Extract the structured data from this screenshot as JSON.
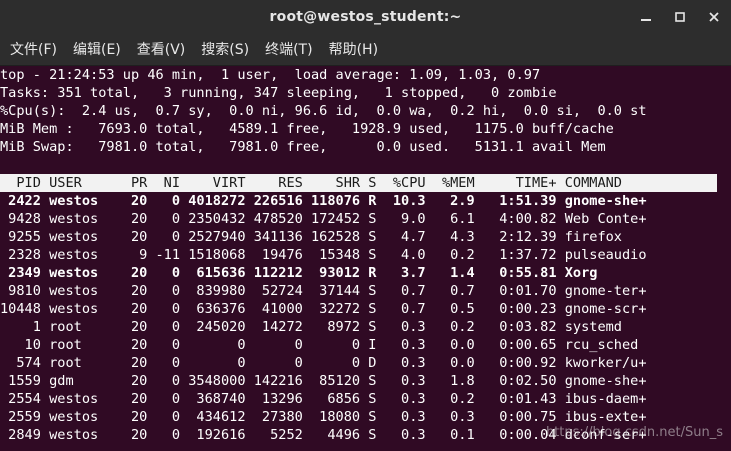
{
  "window": {
    "title": "root@westos_student:~"
  },
  "menu": [
    "文件(F)",
    "编辑(E)",
    "查看(V)",
    "搜索(S)",
    "终端(T)",
    "帮助(H)"
  ],
  "terminal": {
    "summary": [
      "top - 21:24:53 up 46 min,  1 user,  load average: 1.09, 1.03, 0.97",
      "Tasks: 351 total,   3 running, 347 sleeping,   1 stopped,   0 zombie",
      "%Cpu(s):  2.4 us,  0.7 sy,  0.0 ni, 96.6 id,  0.0 wa,  0.2 hi,  0.0 si,  0.0 st",
      "MiB Mem :   7693.0 total,   4589.1 free,   1928.9 used,   1175.0 buff/cache",
      "MiB Swap:   7981.0 total,   7981.0 free,      0.0 used.   5131.1 avail Mem"
    ],
    "blank": " ",
    "header": "  PID USER      PR  NI    VIRT    RES    SHR S  %CPU  %MEM     TIME+ COMMAND",
    "processes": [
      {
        "text": " 2422 westos    20   0 4018272 226516 118076 R  10.3   2.9   1:51.39 gnome-she+",
        "bold": true
      },
      {
        "text": " 9428 westos    20   0 2350432 478520 172452 S   9.0   6.1   4:00.82 Web Conte+",
        "bold": false
      },
      {
        "text": " 9255 westos    20   0 2527940 341136 162528 S   4.7   4.3   2:12.39 firefox",
        "bold": false
      },
      {
        "text": " 2328 westos     9 -11 1518068  19476  15348 S   4.0   0.2   1:37.72 pulseaudio",
        "bold": false
      },
      {
        "text": " 2349 westos    20   0  615636 112212  93012 R   3.7   1.4   0:55.81 Xorg",
        "bold": true
      },
      {
        "text": " 9810 westos    20   0  839980  52724  37144 S   0.7   0.7   0:01.70 gnome-ter+",
        "bold": false
      },
      {
        "text": "10448 westos    20   0  636376  41000  32272 S   0.7   0.5   0:00.23 gnome-scr+",
        "bold": false
      },
      {
        "text": "    1 root      20   0  245020  14272   8972 S   0.3   0.2   0:03.82 systemd",
        "bold": false
      },
      {
        "text": "   10 root      20   0       0      0      0 I   0.3   0.0   0:00.65 rcu_sched",
        "bold": false
      },
      {
        "text": "  574 root      20   0       0      0      0 D   0.3   0.0   0:00.92 kworker/u+",
        "bold": false
      },
      {
        "text": " 1559 gdm       20   0 3548000 142216  85120 S   0.3   1.8   0:02.50 gnome-she+",
        "bold": false
      },
      {
        "text": " 2554 westos    20   0  368740  13296   6856 S   0.3   0.2   0:01.43 ibus-daem+",
        "bold": false
      },
      {
        "text": " 2559 westos    20   0  434612  27380  18080 S   0.3   0.3   0:00.75 ibus-exte+",
        "bold": false
      },
      {
        "text": " 2849 westos    20   0  192616   5252   4496 S   0.3   0.1   0:00.04 dconf-ser+",
        "bold": false
      }
    ]
  },
  "watermark": "https://blog.csdn.net/Sun_s",
  "colors": {
    "terminal_bg": "#300a24",
    "titlebar_bg": "#2d2d2d",
    "header_bg": "#f2f2f2"
  }
}
